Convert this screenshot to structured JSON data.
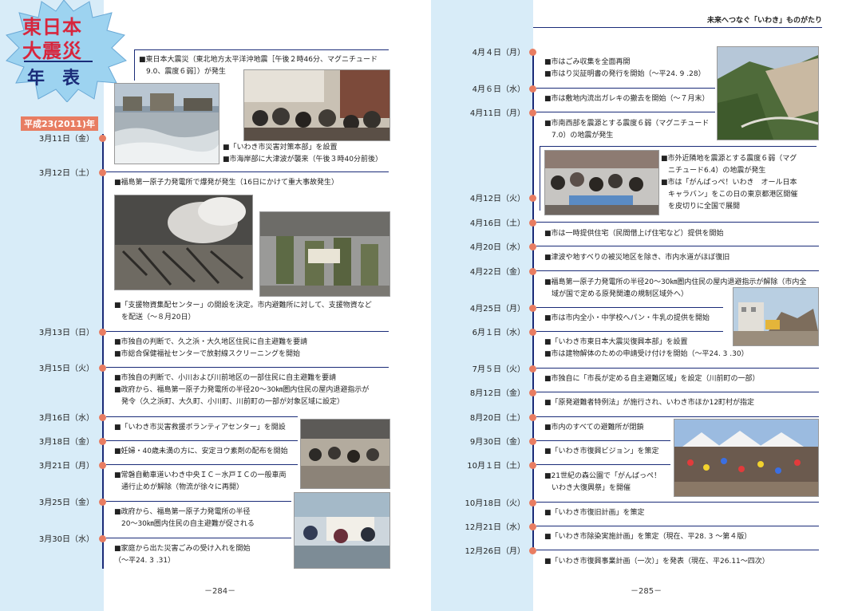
{
  "header": {
    "title_line1": "東日本",
    "title_line2": "大震災",
    "title_line3": "年　表",
    "year_badge": "平成23(2011)年",
    "right_header": "未来へつなぐ「いわき」ものがたり"
  },
  "colors": {
    "navy": "#1a2b78",
    "dot": "#e87d62",
    "strip": "#d8ecf8",
    "badge": "#e87d62",
    "title_red": "#d7263d"
  },
  "left": {
    "dates": [
      "3月11日（金）",
      "3月12日（土）",
      "3月13日（日）",
      "3月15日（火）",
      "3月16日（水）",
      "3月18日（金）",
      "3月21日（月）",
      "3月25日（金）",
      "3月30日（水）"
    ],
    "entries": {
      "e1": [
        "■東日本大震災（東北地方太平洋沖地震［午後２時46分、マグニチュード",
        "　9.0、震度６弱］）が発生"
      ],
      "e2": [
        "■「いわき市災害対策本部」を設置",
        "■市海岸部に大津波が襲来（午後３時40分前後）"
      ],
      "e3": [
        "■福島第一原子力発電所で爆発が発生（16日にかけて重大事故発生）"
      ],
      "e4": [
        "■「支援物資集配センター」の開設を決定。市内避難所に対して、支援物資など",
        "　を配送（～８月20日）"
      ],
      "e5": [
        "■市独自の判断で、久之浜・大久地区住民に自主避難を要請",
        "■市総合保健福祉センターで放射線スクリーニングを開始"
      ],
      "e6": [
        "■市独自の判断で、小川および川前地区の一部住民に自主避難を要請",
        "■政府から、福島第一原子力発電所の半径20～30㎞圏内住民の屋内退避指示が",
        "　発令（久之浜町、大久町、小川町、川前町の一部が対象区域に設定）"
      ],
      "e7": [
        "■「いわき市災害救援ボランティアセンター」を開設"
      ],
      "e8": [
        "■妊婦・40歳未満の方に、安定ヨウ素剤の配布を開始"
      ],
      "e9": [
        "■常磐自動車道いわき中央ＩＣ－水戸ＩＣの一般車両",
        "　通行止めが解除（物流が徐々に再開）"
      ],
      "e10": [
        "■政府から、福島第一原子力発電所の半径",
        "　20～30㎞圏内住民の自主避難が促される"
      ],
      "e11": [
        "■家庭から出た災害ごみの受け入れを開始",
        "（～平24. 3 .31）"
      ]
    },
    "page_number": "－284－"
  },
  "right": {
    "dates": [
      "4月４日（月）",
      "4月６日（水）",
      "4月11日（月）",
      "4月12日（火）",
      "4月16日（土）",
      "4月20日（水）",
      "4月22日（金）",
      "4月25日（月）",
      "6月１日（水）",
      "7月５日（火）",
      "8月12日（金）",
      "8月20日（土）",
      "9月30日（金）",
      "10月１日（土）",
      "10月18日（火）",
      "12月21日（水）",
      "12月26日（月）"
    ],
    "entries": {
      "r1": [
        "■市はごみ収集を全面再開",
        "■市はり災証明書の発行を開始（～平24. 9 .28）"
      ],
      "r2": [
        "■市は敷地内流出ガレキの撤去を開始（～７月末）"
      ],
      "r3": [
        "■市南西部を震源とする震度６弱（マグニチュード",
        "　7.0）の地震が発生"
      ],
      "r4": [
        "■市外近隣地を震源とする震度６弱（マグ",
        "　ニチュード6.4）の地震が発生",
        "■市は「がんばっぺ！いわき　オール日本",
        "　キャラバン」をこの日の東京都港区開催",
        "　を皮切りに全国で展開"
      ],
      "r5": [
        "■市は一時提供住宅（民間借上げ住宅など）提供を開始"
      ],
      "r6": [
        "■津波や地すべりの被災地区を除き、市内水道がほぼ復旧"
      ],
      "r7": [
        "■福島第一原子力発電所の半径20～30㎞圏内住民の屋内退避指示が解除（市内全",
        "　域が国で定める原発関連の規制区域外へ）"
      ],
      "r8": [
        "■市は市内全小・中学校へパン・牛乳の提供を開始"
      ],
      "r9": [
        "■「いわき市東日本大震災復興本部」を設置",
        "■市は建物解体のための申請受け付けを開始（～平24. 3 .30）"
      ],
      "r10": [
        "■市独自に「市長が定める自主避難区域」を設定（川前町の一部）"
      ],
      "r11": [
        "■「原発避難者特例法」が施行され、いわき市ほか12町村が指定"
      ],
      "r12": [
        "■市内のすべての避難所が閉鎖"
      ],
      "r13": [
        "■「いわき市復興ビジョン」を策定"
      ],
      "r14": [
        "■21世紀の森公園で「がんばっぺ！",
        "　いわき大復興祭」を開催"
      ],
      "r15": [
        "■「いわき市復旧計画」を策定"
      ],
      "r16": [
        "■「いわき市除染実施計画」を策定（現在、平28. 3 ～第４版）"
      ],
      "r17": [
        "■「いわき市復興事業計画（一次）」を発表（現在、平26.11～四次）"
      ]
    },
    "page_number": "－285－"
  }
}
